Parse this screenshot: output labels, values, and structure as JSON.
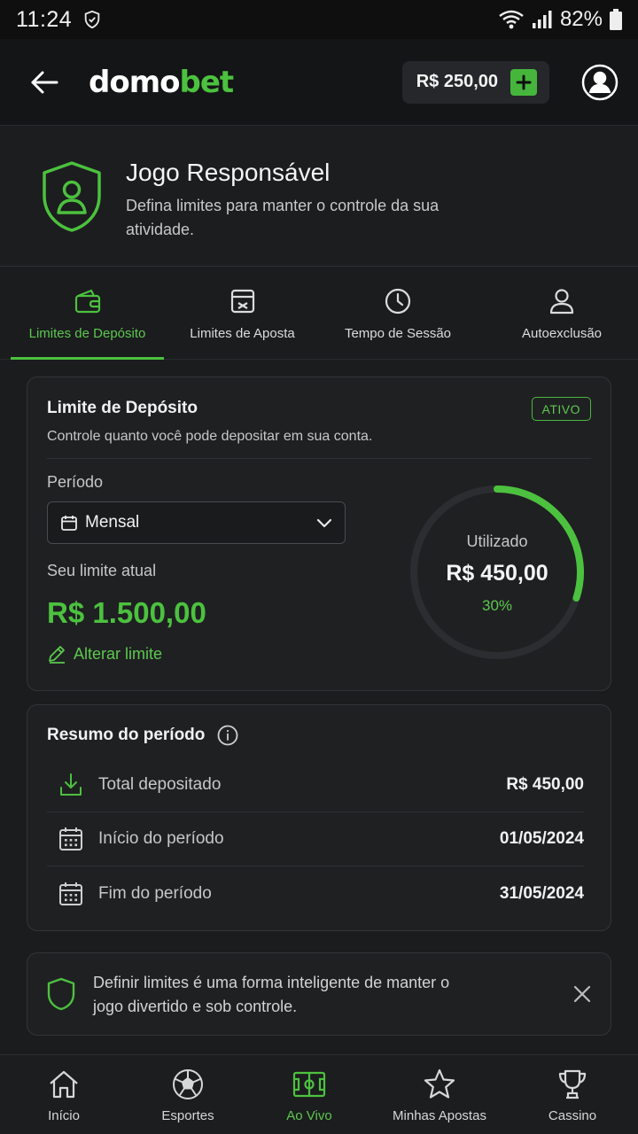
{
  "status_bar": {
    "time": "11:24",
    "battery": "82%"
  },
  "header": {
    "logo_part1": "domo",
    "logo_part2": "bet",
    "balance": "R$ 250,00"
  },
  "hero": {
    "title": "Jogo Responsável",
    "description": "Defina limites para manter o controle da sua atividade."
  },
  "tabs": [
    {
      "label": "Limites de Depósito",
      "icon": "wallet-icon",
      "active": true
    },
    {
      "label": "Limites de Aposta",
      "icon": "ticket-icon",
      "active": false
    },
    {
      "label": "Tempo de Sessão",
      "icon": "clock-icon",
      "active": false
    },
    {
      "label": "Autoexclusão",
      "icon": "user-icon",
      "active": false
    }
  ],
  "deposit_limit": {
    "title": "Limite de Depósito",
    "badge": "ATIVO",
    "subtitle": "Controle quanto você pode depositar em sua conta.",
    "period_label": "Período",
    "period_value": "Mensal",
    "current_limit_label": "Seu limite atual",
    "current_limit_value": "R$ 1.500,00",
    "edit_label": "Alterar limite",
    "used_label": "Utilizado",
    "used_value": "R$ 450,00",
    "used_percent": "30%",
    "used_fraction": 0.3
  },
  "summary": {
    "title": "Resumo do período",
    "rows": [
      {
        "icon": "download-icon",
        "label": "Total depositado",
        "value": "R$ 450,00"
      },
      {
        "icon": "calendar-icon",
        "label": "Início do período",
        "value": "01/05/2024"
      },
      {
        "icon": "calendar-icon",
        "label": "Fim do período",
        "value": "31/05/2024"
      }
    ]
  },
  "tip": {
    "text": "Definir limites é uma forma inteligente de manter o jogo divertido e sob controle."
  },
  "bottom_nav": [
    {
      "label": "Início",
      "icon": "home-icon",
      "active": false
    },
    {
      "label": "Esportes",
      "icon": "soccer-ball-icon",
      "active": false
    },
    {
      "label": "Ao Vivo",
      "icon": "field-icon",
      "active": true
    },
    {
      "label": "Minhas Apostas",
      "icon": "star-icon",
      "active": false
    },
    {
      "label": "Cassino",
      "icon": "trophy-icon",
      "active": false
    }
  ],
  "colors": {
    "accent": "#4cc13f",
    "background": "#1b1c1e",
    "card": "#1f2022"
  }
}
